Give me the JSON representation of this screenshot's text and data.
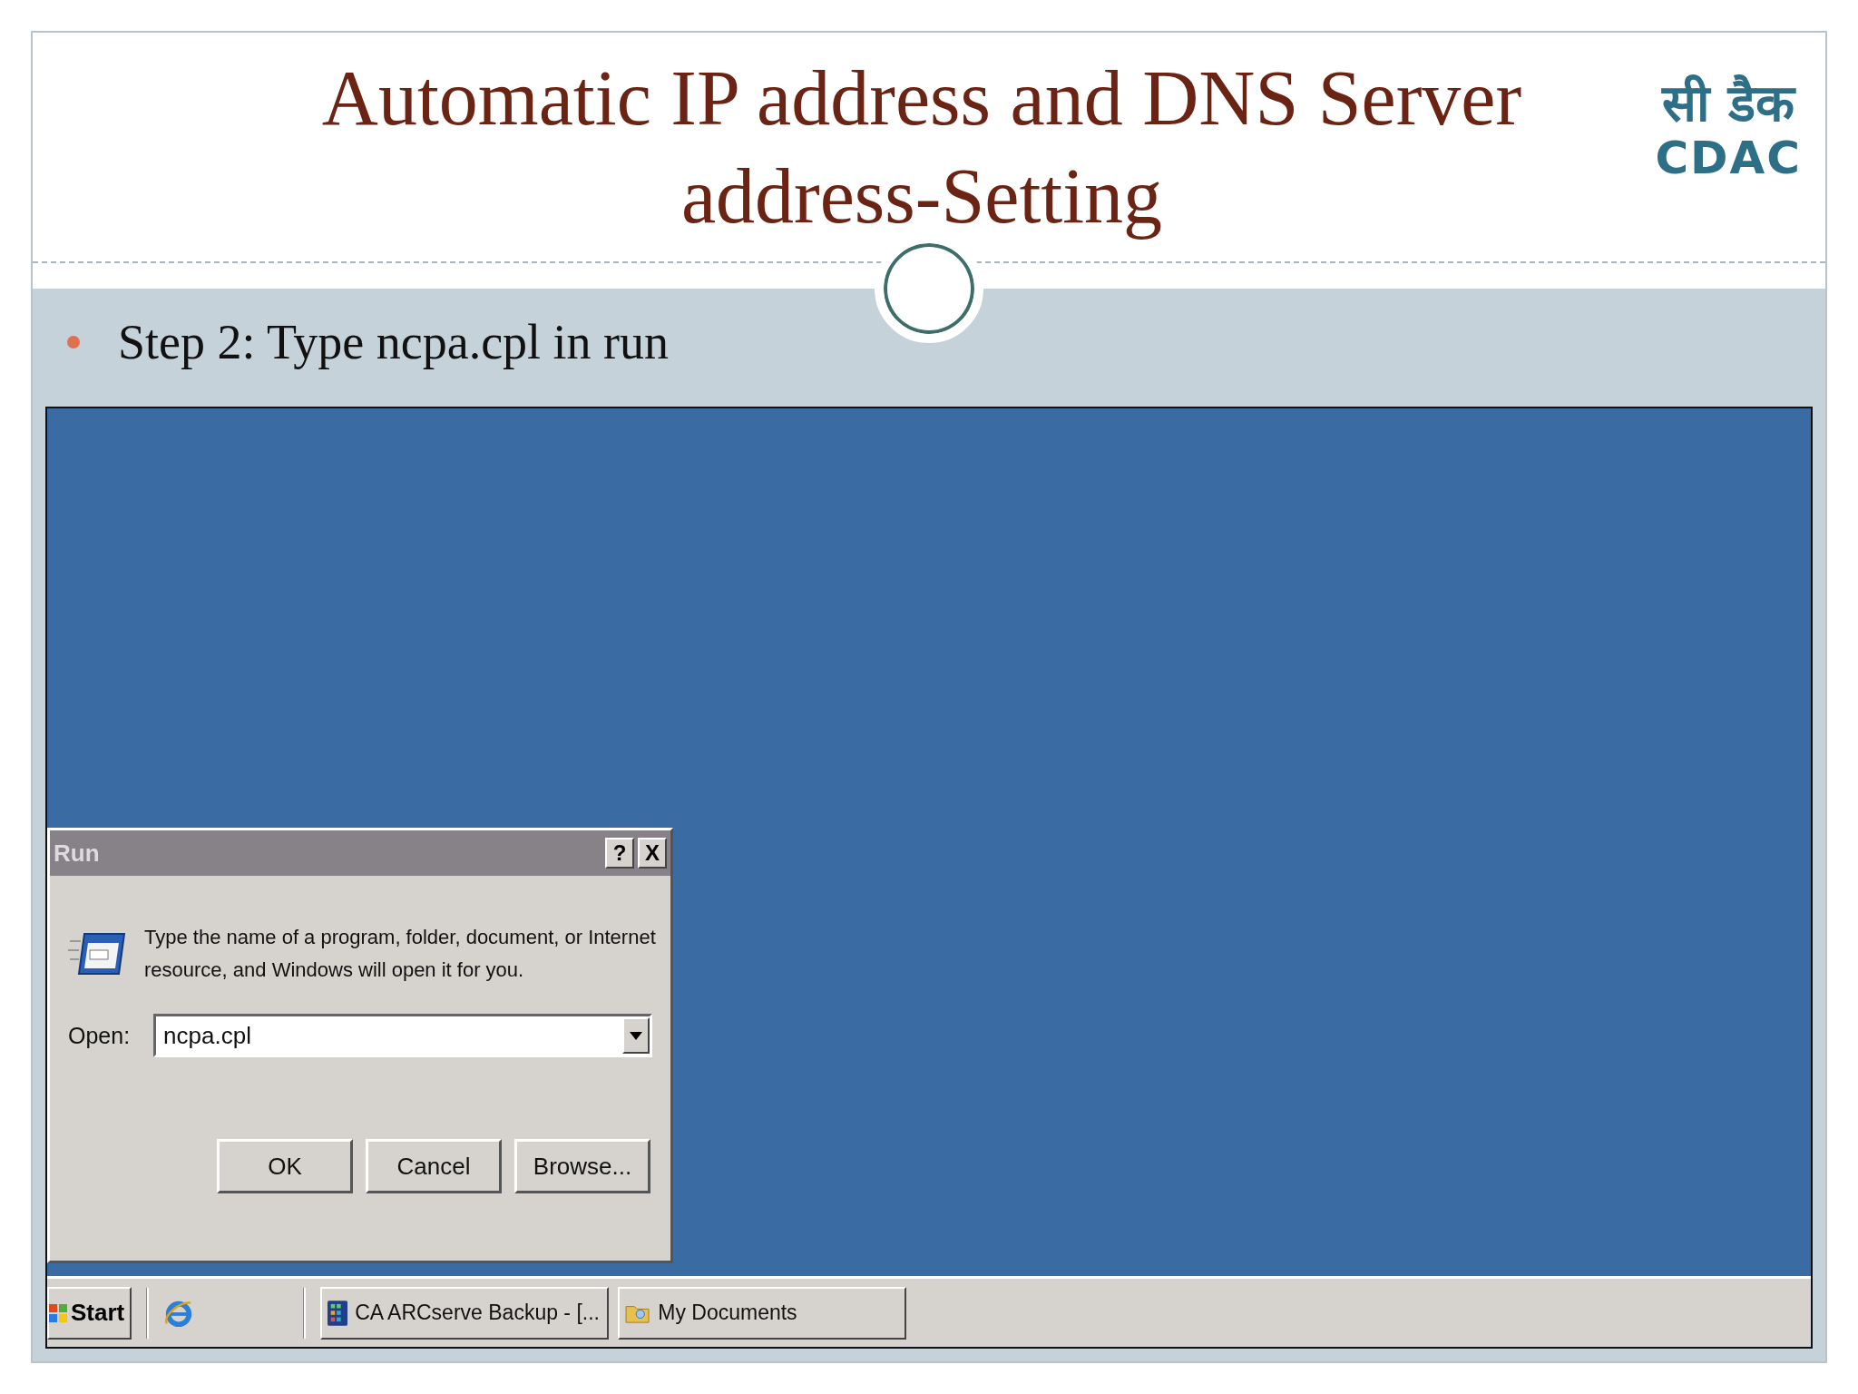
{
  "slide": {
    "title": "Automatic IP address and DNS Server address-Setting",
    "logo": {
      "hindi": "सी डैक",
      "latin": "CDAC"
    },
    "bullets": [
      "Step 2: Type ncpa.cpl in run"
    ]
  },
  "desktop": {
    "dialog": {
      "title": "Run",
      "title_buttons": [
        "?",
        "X"
      ],
      "message": "Type the name of a program, folder, document, or Internet resource, and Windows will open it for you.",
      "open_label": "Open:",
      "open_value": "ncpa.cpl",
      "buttons": [
        "OK",
        "Cancel",
        "Browse..."
      ]
    },
    "taskbar": {
      "start": "Start",
      "tasks": [
        {
          "label": "CA ARCserve Backup - [...",
          "kind": "app"
        },
        {
          "label": "My Documents",
          "kind": "folder"
        }
      ]
    }
  }
}
